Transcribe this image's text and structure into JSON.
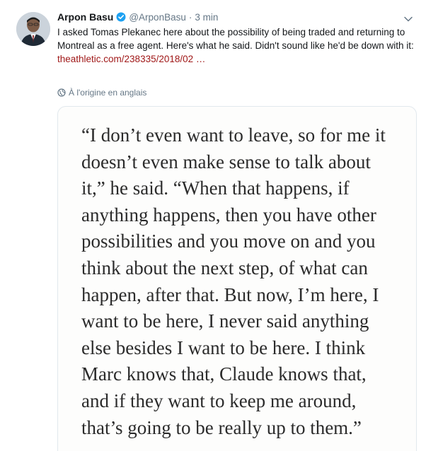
{
  "tweet": {
    "author_name": "Arpon Basu",
    "handle": "@ArponBasu",
    "separator": "·",
    "time": "3 min",
    "verified": true,
    "text": "I asked Tomas Plekanec here about the possibility of being traded and returning to Montreal as a free agent. Here's what he said. Didn't sound like he'd be down with it:",
    "link_text": "theathletic.com/238335/2018/02 …",
    "translate_label": "À l'origine en anglais",
    "icons": {
      "avatar": "author-avatar",
      "verified": "verified-badge-icon",
      "caret": "chevron-down-icon",
      "globe": "globe-icon"
    }
  },
  "quote_image": {
    "lines": [
      "“I don’t even want to leave, so for me it",
      "doesn’t even make sense to talk about",
      "it,” he said. “When that happens, if",
      "anything happens, then you have other",
      "possibilities and you move on and you",
      "think about the next step, of what can",
      "happen, after that. But now, I’m here, I",
      "want to be here, I never said anything",
      "else besides I want to be here. I think",
      "Marc knows that, Claude knows that,",
      "and if they want to keep me around,",
      "that’s going to be really up to them.”"
    ]
  },
  "colors": {
    "text": "#14171a",
    "muted": "#657786",
    "link": "#a01818",
    "verified": "#1da1f2",
    "border": "#e1e8ed"
  }
}
